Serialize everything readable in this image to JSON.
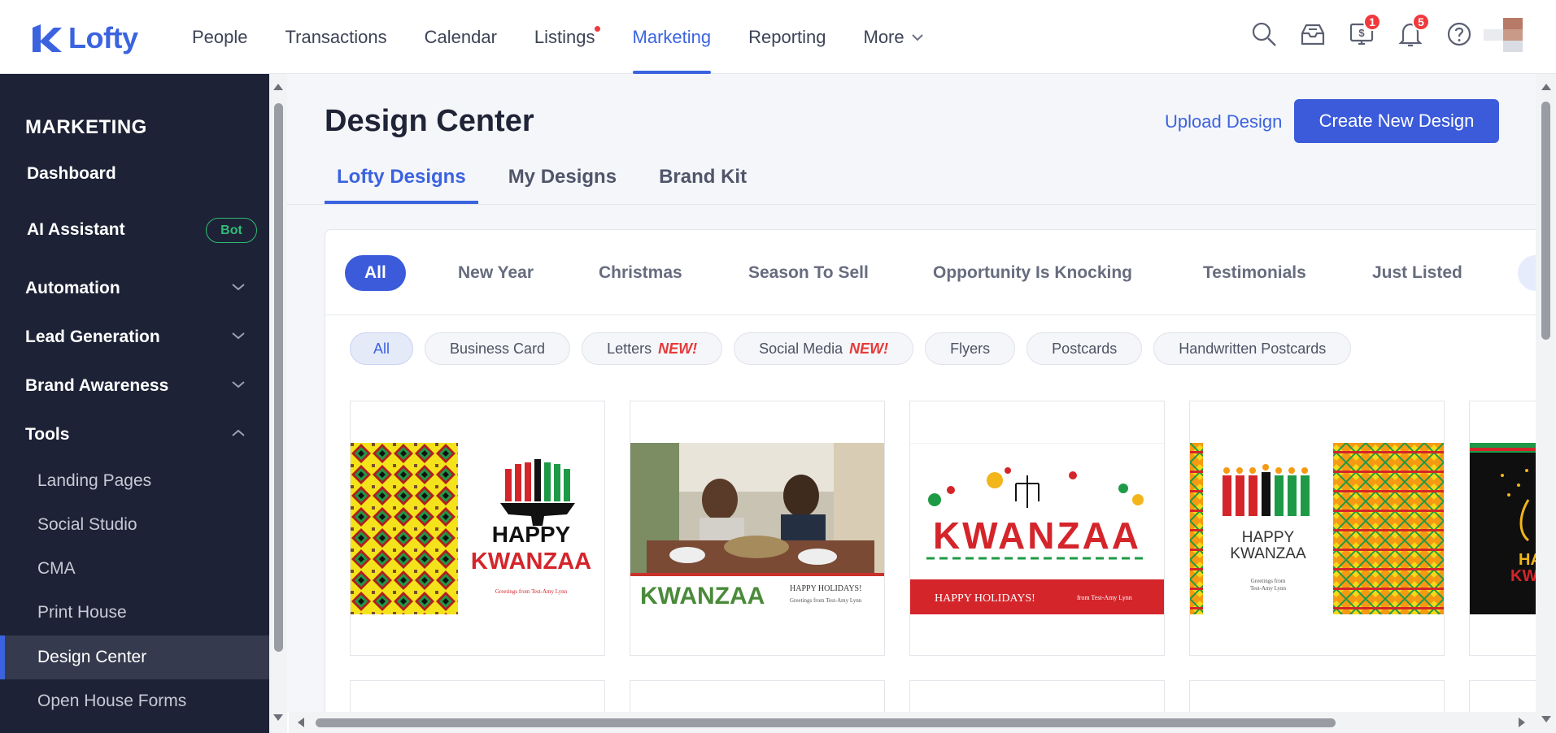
{
  "app": {
    "logo_text": "Lofty",
    "brand_color": "#3b63e0"
  },
  "nav": {
    "items": [
      {
        "label": "People"
      },
      {
        "label": "Transactions"
      },
      {
        "label": "Calendar"
      },
      {
        "label": "Listings"
      },
      {
        "label": "Marketing"
      },
      {
        "label": "Reporting"
      },
      {
        "label": "More"
      }
    ],
    "active": "Marketing",
    "badges": {
      "sales": "1",
      "notifications": "5"
    }
  },
  "sidebar": {
    "title": "MARKETING",
    "dashboard": "Dashboard",
    "ai_assistant": "AI Assistant",
    "ai_badge": "Bot",
    "automation": "Automation",
    "lead_generation": "Lead Generation",
    "brand_awareness": "Brand Awareness",
    "tools": "Tools",
    "tools_items": [
      {
        "label": "Landing Pages"
      },
      {
        "label": "Social Studio"
      },
      {
        "label": "CMA"
      },
      {
        "label": "Print House"
      },
      {
        "label": "Design Center"
      },
      {
        "label": "Open House Forms"
      }
    ]
  },
  "main": {
    "title": "Design Center",
    "upload_label": "Upload Design",
    "create_label": "Create New Design",
    "tabs": [
      {
        "label": "Lofty Designs"
      },
      {
        "label": "My Designs"
      },
      {
        "label": "Brand Kit"
      }
    ],
    "categories": [
      {
        "label": "All"
      },
      {
        "label": "New Year"
      },
      {
        "label": "Christmas"
      },
      {
        "label": "Season To Sell"
      },
      {
        "label": "Opportunity Is Knocking"
      },
      {
        "label": "Testimonials"
      },
      {
        "label": "Just Listed"
      }
    ],
    "types": [
      {
        "label": "All"
      },
      {
        "label": "Business Card"
      },
      {
        "label": "Letters",
        "tag": "NEW!"
      },
      {
        "label": "Social Media",
        "tag": "NEW!"
      },
      {
        "label": "Flyers"
      },
      {
        "label": "Postcards"
      },
      {
        "label": "Handwritten Postcards"
      }
    ]
  },
  "cards": {
    "c1": {
      "line1": "HAPPY",
      "line2": "KWANZAA",
      "line3": "Greetings from Test-Amy Lynn"
    },
    "c2": {
      "word": "KWANZAA",
      "line1": "HAPPY HOLIDAYS!",
      "line2": "Greetings from Test-Amy Lynn"
    },
    "c3": {
      "word": "KWANZAA",
      "line1": "HAPPY HOLIDAYS!",
      "line2": "from Test-Amy Lynn"
    },
    "c4": {
      "line1": "HAPPY",
      "line2": "KWANZAA",
      "line3": "Greetings from",
      "line4": "Test-Amy Lynn"
    },
    "c5": {
      "line1": "HA",
      "line2": "KWA"
    }
  }
}
